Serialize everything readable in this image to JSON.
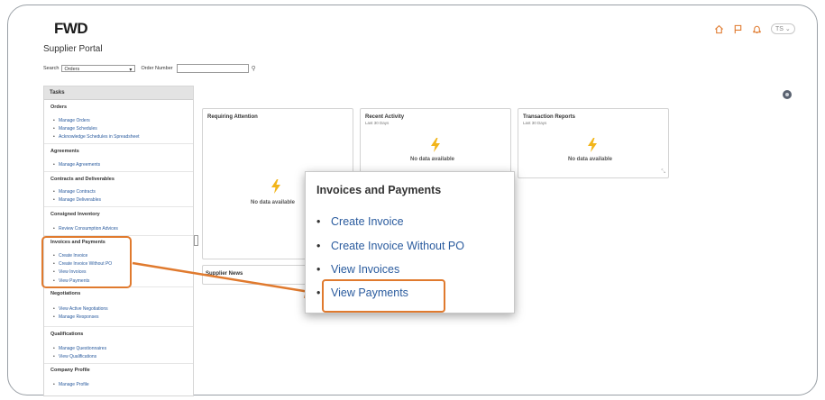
{
  "header": {
    "logo": "FWD",
    "avatar_initials": "TS",
    "avatar_chevron": "⌄"
  },
  "portal_title": "Supplier Portal",
  "search": {
    "label": "Search",
    "selected": "Orders",
    "field_label": "Order Number",
    "value": ""
  },
  "tasks": {
    "header": "Tasks",
    "sections": [
      {
        "title": "Orders",
        "items": [
          "Manage Orders",
          "Manage Schedules",
          "Acknowledge Schedules in Spreadsheet"
        ]
      },
      {
        "title": "Agreements",
        "items": [
          "Manage Agreements"
        ]
      },
      {
        "title": "Contracts and Deliverables",
        "items": [
          "Manage Contracts",
          "Manage Deliverables"
        ]
      },
      {
        "title": "Consigned Inventory",
        "items": [
          "Review Consumption Advices"
        ]
      },
      {
        "title": "Invoices and Payments",
        "items": [
          "Create Invoice",
          "Create Invoice Without PO",
          "View Invoices",
          "View Payments"
        ]
      },
      {
        "title": "Negotiations",
        "items": [
          "View Active Negotiations",
          "Manage Responses"
        ]
      },
      {
        "title": "Qualifications",
        "items": [
          "Manage Questionnaires",
          "View Qualifications"
        ]
      },
      {
        "title": "Company Profile",
        "items": [
          "Manage Profile"
        ]
      }
    ]
  },
  "cards": {
    "requiring_attention": {
      "title": "Requiring Attention",
      "empty": "No data available"
    },
    "recent_activity": {
      "title": "Recent Activity",
      "subtitle": "Last 30 Days",
      "empty": "No data available"
    },
    "transaction_reports": {
      "title": "Transaction Reports",
      "subtitle": "Last 30 Days",
      "empty": "No data available"
    },
    "supplier_news": {
      "title": "Supplier News"
    }
  },
  "callout": {
    "title": "Invoices and Payments",
    "items": [
      "Create Invoice",
      "Create Invoice Without PO",
      "View Invoices",
      "View Payments"
    ]
  },
  "colors": {
    "highlight": "#e07a2e",
    "link": "#2a5b9e",
    "bolt": "#f2b51a",
    "header_icons": "#e07a2e"
  }
}
